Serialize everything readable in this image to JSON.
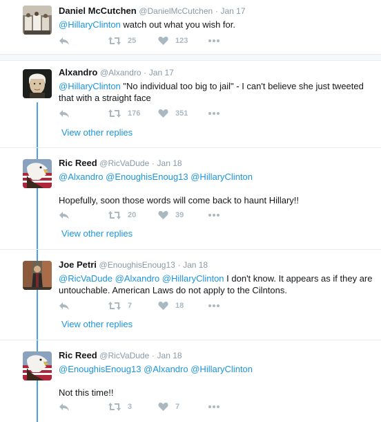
{
  "tweets": [
    {
      "name": "Daniel McCutchen",
      "handle": "@DanielMcCutchen",
      "time": "Jan 17",
      "mention": "@HillaryClinton",
      "text": " watch out what you wish for.",
      "retweets": "25",
      "likes": "123"
    },
    {
      "name": "Alxandro",
      "handle": "@Alxandro",
      "time": "Jan 17",
      "mention": "@HillaryClinton",
      "text": " \"No individual too big to jail\" - I can't believe she just tweeted that with a straight face",
      "retweets": "176",
      "likes": "351",
      "view_replies": "View other replies"
    },
    {
      "name": "Ric Reed",
      "handle": "@RicVaDude",
      "time": "Jan 18",
      "mentions": [
        "@Alxandro",
        "@EnoughisEnoug13",
        "@HillaryClinton"
      ],
      "text": "Hopefully, soon those words will come back to haunt Hillary!!",
      "retweets": "20",
      "likes": "39",
      "view_replies": "View other replies"
    },
    {
      "name": "Joe Petri",
      "handle": "@EnoughisEnoug13",
      "time": "Jan 18",
      "mentions": [
        "@RicVaDude",
        "@Alxandro",
        "@HillaryClinton"
      ],
      "text": " I don't know. It appears as if they are untouchable. American Laws do not apply to the Cilntons.",
      "retweets": "7",
      "likes": "18",
      "view_replies": "View other replies"
    },
    {
      "name": "Ric Reed",
      "handle": "@RicVaDude",
      "time": "Jan 18",
      "mentions": [
        "@EnoughisEnoug13",
        "@Alxandro",
        "@HillaryClinton"
      ],
      "text": "Not this time!!",
      "retweets": "3",
      "likes": "7"
    }
  ],
  "dot": "·",
  "colors": {
    "link": "#1b95e0",
    "thread": "#4ba1e4",
    "muted": "#8899a6",
    "icon": "#aab8c2"
  }
}
